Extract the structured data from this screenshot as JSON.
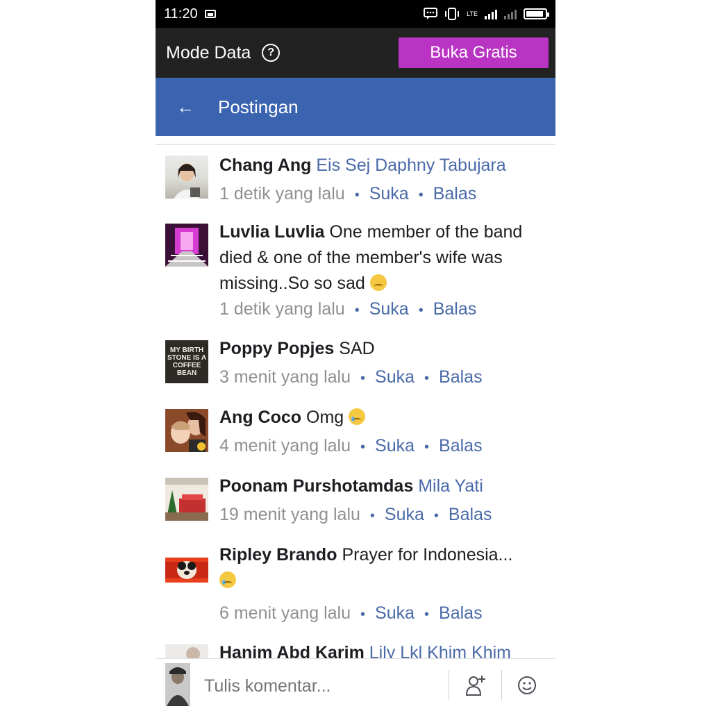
{
  "status_bar": {
    "time": "11:20",
    "lte_label": "LTE"
  },
  "data_bar": {
    "mode_label": "Mode Data",
    "help_glyph": "?",
    "free_button": "Buka Gratis"
  },
  "header": {
    "back_glyph": "←",
    "title": "Postingan"
  },
  "comments": [
    {
      "name": "Chang Ang",
      "tag": "Eis Sej Daphny Tabujara",
      "text": "",
      "emoji": "",
      "time": "1 detik yang lalu",
      "like": "Suka",
      "reply": "Balas"
    },
    {
      "name": "Luvlia Luvlia",
      "tag": "",
      "text": "One member of the band died & one of the member's wife was missing..So so sad",
      "emoji": "sad",
      "time": "1 detik yang lalu",
      "like": "Suka",
      "reply": "Balas"
    },
    {
      "name": "Poppy Popjes",
      "tag": "",
      "text": "SAD",
      "emoji": "",
      "time": "3 menit yang lalu",
      "like": "Suka",
      "reply": "Balas",
      "avatar_text": "MY BIRTH STONE IS A COFFEE BEAN"
    },
    {
      "name": "Ang Coco",
      "tag": "",
      "text": "Omg",
      "emoji": "tear",
      "time": "4 menit yang lalu",
      "like": "Suka",
      "reply": "Balas"
    },
    {
      "name": "Poonam Purshotamdas",
      "tag": "Mila Yati",
      "text": "",
      "emoji": "",
      "time": "19 menit yang lalu",
      "like": "Suka",
      "reply": "Balas"
    },
    {
      "name": "Ripley Brando",
      "tag": "",
      "text": "Prayer for Indonesia...",
      "emoji": "sad",
      "time": "6 menit yang lalu",
      "like": "Suka",
      "reply": "Balas"
    },
    {
      "name": "Hanim Abd Karim",
      "tag": "Lily Lkl Khim Khim",
      "text": "",
      "emoji": "",
      "time": "",
      "like": "",
      "reply": ""
    }
  ],
  "meta_separator": "•",
  "composer": {
    "placeholder": "Tulis komentar..."
  },
  "icons": [
    "image-icon",
    "message-icon",
    "vibrate-icon",
    "signal-icon",
    "battery-icon",
    "help-icon",
    "back-arrow-icon",
    "tag-friend-icon",
    "emoji-icon"
  ],
  "colors": {
    "header_blue": "#3b64b0",
    "free_button_purple": "#b934c3",
    "link_blue": "#4a6aa8",
    "data_bar": "#222222"
  }
}
